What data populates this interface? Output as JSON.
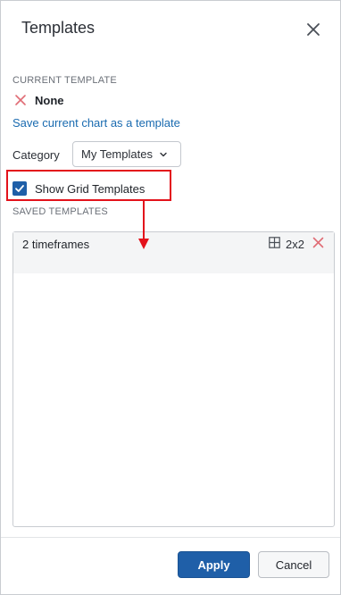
{
  "dialog": {
    "title": "Templates"
  },
  "current_template": {
    "section_label": "CURRENT TEMPLATE",
    "value": "None",
    "save_link": "Save current chart as a template"
  },
  "category": {
    "label": "Category",
    "selected": "My Templates"
  },
  "show_grid": {
    "label": "Show Grid Templates",
    "checked": true
  },
  "saved_templates": {
    "section_label": "SAVED TEMPLATES",
    "items": [
      {
        "name": "2 timeframes",
        "layout": "2x2"
      }
    ]
  },
  "footer": {
    "apply_label": "Apply",
    "cancel_label": "Cancel"
  },
  "colors": {
    "accent": "#1f5fa8",
    "link": "#1a6bb0",
    "highlight": "#e3121b",
    "delete": "#e06c75"
  }
}
